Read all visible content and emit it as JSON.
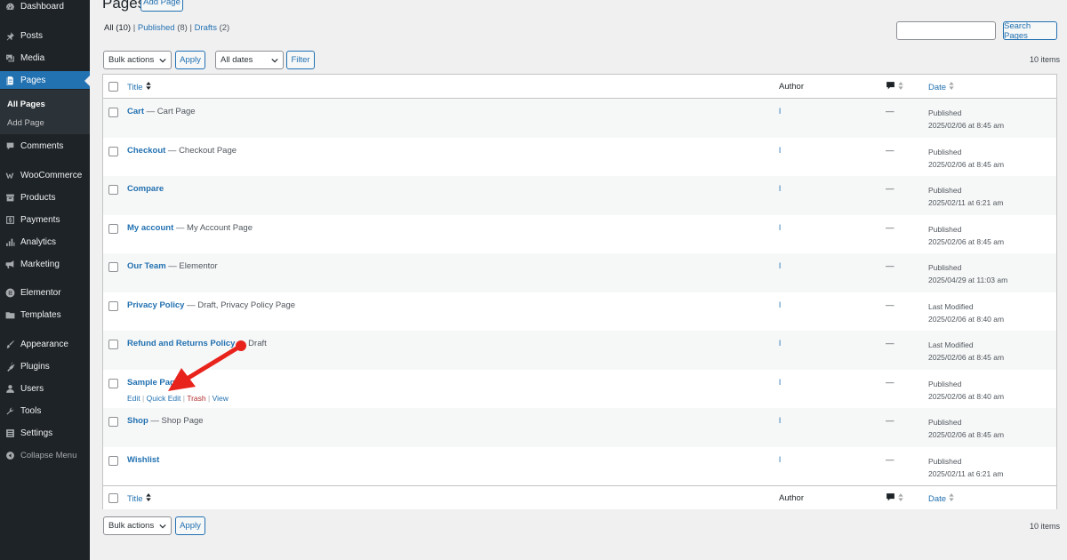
{
  "sidebar": {
    "items": [
      {
        "label": "Dashboard",
        "icon": "dashboard-icon"
      },
      {
        "label": "Posts",
        "icon": "pin-icon"
      },
      {
        "label": "Media",
        "icon": "media-icon"
      },
      {
        "label": "Pages",
        "icon": "pages-icon"
      },
      {
        "label": "Comments",
        "icon": "comment-icon"
      },
      {
        "label": "WooCommerce",
        "icon": "woocommerce-icon"
      },
      {
        "label": "Products",
        "icon": "archive-icon"
      },
      {
        "label": "Payments",
        "icon": "dollar-icon"
      },
      {
        "label": "Analytics",
        "icon": "bar-chart-icon"
      },
      {
        "label": "Marketing",
        "icon": "megaphone-icon"
      },
      {
        "label": "Elementor",
        "icon": "elementor-icon"
      },
      {
        "label": "Templates",
        "icon": "folder-icon"
      },
      {
        "label": "Appearance",
        "icon": "brush-icon"
      },
      {
        "label": "Plugins",
        "icon": "plug-icon"
      },
      {
        "label": "Users",
        "icon": "user-icon"
      },
      {
        "label": "Tools",
        "icon": "wrench-icon"
      },
      {
        "label": "Settings",
        "icon": "settings-icon"
      }
    ],
    "submenu": [
      "All Pages",
      "Add Page"
    ],
    "collapse_label": "Collapse Menu"
  },
  "header": {
    "title": "Pages",
    "add_button": "Add Page"
  },
  "views": {
    "all": "All",
    "all_count": "(10)",
    "published": "Published",
    "published_count": "(8)",
    "drafts": "Drafts",
    "drafts_count": "(2)",
    "sep": "|"
  },
  "search": {
    "button": "Search Pages",
    "value": ""
  },
  "toolbar": {
    "bulk_actions": "Bulk actions",
    "apply": "Apply",
    "all_dates": "All dates",
    "filter": "Filter",
    "items_count": "10 items"
  },
  "table": {
    "columns": {
      "title": "Title",
      "author": "Author",
      "date": "Date"
    },
    "rows": [
      {
        "title": "Cart",
        "state": " — Cart Page",
        "author": "l",
        "comments": "—",
        "status": "Published",
        "date": "2025/02/06 at 8:45 am"
      },
      {
        "title": "Checkout",
        "state": " — Checkout Page",
        "author": "l",
        "comments": "—",
        "status": "Published",
        "date": "2025/02/06 at 8:45 am"
      },
      {
        "title": "Compare",
        "state": "",
        "author": "l",
        "comments": "—",
        "status": "Published",
        "date": "2025/02/11 at 6:21 am"
      },
      {
        "title": "My account",
        "state": " — My Account Page",
        "author": "l",
        "comments": "—",
        "status": "Published",
        "date": "2025/02/06 at 8:45 am"
      },
      {
        "title": "Our Team",
        "state": " — Elementor",
        "author": "l",
        "comments": "—",
        "status": "Published",
        "date": "2025/04/29 at 11:03 am"
      },
      {
        "title": "Privacy Policy",
        "state": " — Draft, Privacy Policy Page",
        "author": "l",
        "comments": "—",
        "status": "Last Modified",
        "date": "2025/02/06 at 8:40 am"
      },
      {
        "title": "Refund and Returns Policy",
        "state": " — Draft",
        "author": "l",
        "comments": "—",
        "status": "Last Modified",
        "date": "2025/02/06 at 8:45 am"
      },
      {
        "title": "Sample Page",
        "state": "",
        "author": "l",
        "comments": "—",
        "status": "Published",
        "date": "2025/02/06 at 8:40 am"
      },
      {
        "title": "Shop",
        "state": " — Shop Page",
        "author": "l",
        "comments": "—",
        "status": "Published",
        "date": "2025/02/06 at 8:45 am"
      },
      {
        "title": "Wishlist",
        "state": "",
        "author": "l",
        "comments": "—",
        "status": "Published",
        "date": "2025/02/11 at 6:21 am"
      }
    ],
    "row_actions": {
      "edit": "Edit",
      "quick_edit": "Quick Edit",
      "trash": "Trash",
      "view": "View",
      "sep": "|"
    }
  },
  "annotation": {
    "arrow_color": "#e8231b"
  },
  "colors": {
    "accent": "#2271b1",
    "sidebar_bg": "#1d2327"
  }
}
